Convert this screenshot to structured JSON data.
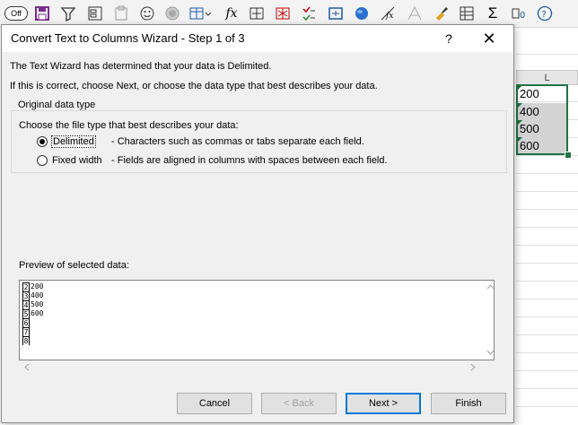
{
  "toolbar": {
    "off_label": "Off",
    "icons": [
      "save-icon",
      "filter-icon",
      "form-icon",
      "paste-icon",
      "smiley-icon",
      "circle-icon",
      "table-icon",
      "function-icon",
      "merge-icon",
      "unmerge-icon",
      "conditional-format-icon",
      "frame-icon",
      "sphere-icon",
      "fx-angle-icon",
      "aa-icon",
      "brush-icon",
      "grid-icon",
      "sigma-icon",
      "number-format-icon",
      "help-icon"
    ],
    "function_glyph": "fx"
  },
  "sheet": {
    "column_header": "L",
    "cells": [
      "200",
      "400",
      "500",
      "600"
    ]
  },
  "dialog": {
    "title": "Convert Text to Columns Wizard - Step 1 of 3",
    "help_label": "?",
    "close_label": "✕",
    "intro_line1": "The Text Wizard has determined that your data is Delimited.",
    "intro_line2": "If this is correct, choose Next, or choose the data type that best describes your data.",
    "group_title": "Original data type",
    "choose_label": "Choose the file type that best describes your data:",
    "options": [
      {
        "label": "Delimited",
        "description": "- Characters such as commas or tabs separate each field.",
        "selected": true
      },
      {
        "label": "Fixed width",
        "description": "- Fields are aligned in columns with spaces between each field.",
        "selected": false
      }
    ],
    "preview_label": "Preview of selected data:",
    "preview_rows": [
      {
        "num": "2",
        "value": "200"
      },
      {
        "num": "3",
        "value": "400"
      },
      {
        "num": "4",
        "value": "500"
      },
      {
        "num": "5",
        "value": "600"
      },
      {
        "num": "6",
        "value": ""
      },
      {
        "num": "7",
        "value": ""
      },
      {
        "num": "8",
        "value": ""
      }
    ],
    "buttons": {
      "cancel": "Cancel",
      "back": "< Back",
      "next": "Next >",
      "finish": "Finish"
    }
  }
}
